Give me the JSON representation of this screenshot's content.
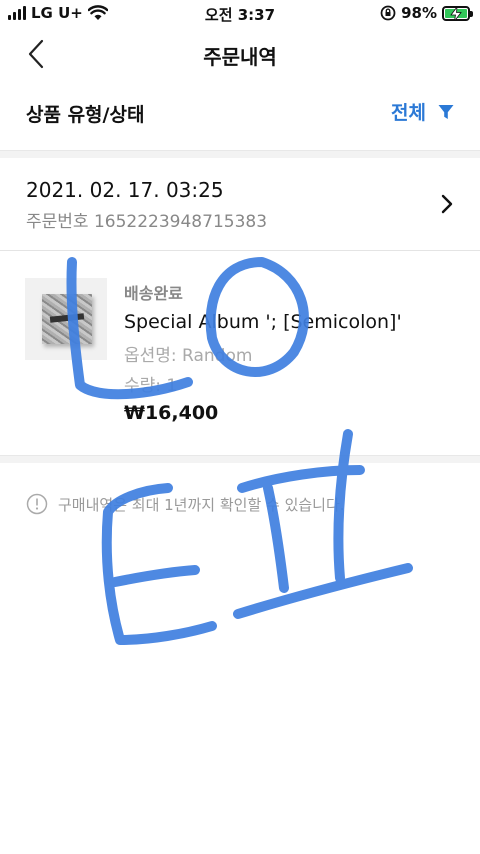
{
  "status_bar": {
    "carrier": "LG U+",
    "time": "오전 3:37",
    "battery_percent": "98%",
    "battery_level": 0.98,
    "icons": [
      "signal-icon",
      "wifi-icon",
      "rotation-lock-icon",
      "battery-charging-icon"
    ]
  },
  "nav": {
    "title": "주문내역",
    "back_icon": "chevron-left-icon"
  },
  "filter": {
    "label": "상품 유형/상태",
    "value": "전체",
    "icon": "funnel-icon"
  },
  "order": {
    "date": "2021. 02. 17. 03:25",
    "order_number": "주문번호 1652223948715383",
    "icon": "chevron-right-icon"
  },
  "product": {
    "status": "배송완료",
    "name": "Special Album '; [Semicolon]'",
    "option": "옵션명: Random",
    "quantity": "수량: 1",
    "price": "₩16,400"
  },
  "notice": {
    "text": "구매내역은 최대 1년까지 확인할 수 있습니다.",
    "icon": "info-icon"
  },
  "colors": {
    "accent": "#2b79d6",
    "handwriting": "#3f7fe0",
    "muted": "#888888",
    "battery": "#32c759"
  }
}
